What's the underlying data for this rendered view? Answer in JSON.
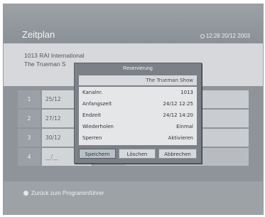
{
  "header": {
    "title": "Zeitplan",
    "datetime": "12:28 20/12 2003"
  },
  "info": {
    "channel": "1013 RAI International",
    "program": "The Trueman S"
  },
  "rows": [
    {
      "num": "1",
      "date": "25/12"
    },
    {
      "num": "2",
      "date": "27/12"
    },
    {
      "num": "3",
      "date": "30/12"
    },
    {
      "num": "4",
      "date": "__/__"
    }
  ],
  "dialog": {
    "title": "Reservierung",
    "program": "The Trueman Show",
    "fields": [
      {
        "label": "Kanalnr.",
        "value": "1013"
      },
      {
        "label": "Anfangszeit",
        "value": "24/12 12:25"
      },
      {
        "label": "Endzeit",
        "value": "24/12 14:20"
      },
      {
        "label": "Wiederholen",
        "value": "Einmal"
      },
      {
        "label": "Sperren",
        "value": "Aktivieren"
      }
    ],
    "buttons": {
      "save": "Speichern",
      "delete": "Löschen",
      "cancel": "Abbrechen"
    }
  },
  "footer": {
    "back": "Zurück zum Programmführer"
  }
}
